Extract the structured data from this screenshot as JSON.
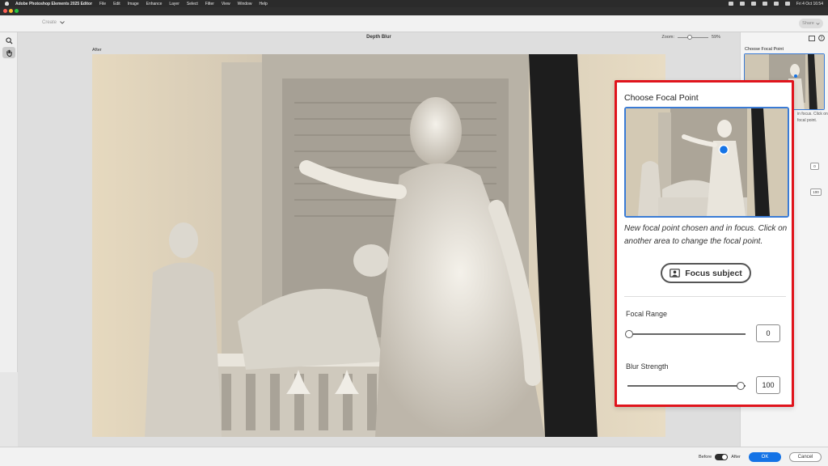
{
  "menubar": {
    "app_name": "Adobe Photoshop Elements 2025 Editor",
    "items": [
      "File",
      "Edit",
      "Image",
      "Enhance",
      "Layer",
      "Select",
      "Filter",
      "View",
      "Window",
      "Help"
    ],
    "datetime": "Fri 4 Oct  16:54"
  },
  "toolbar": {
    "create_label": "Create",
    "share_label": "Share"
  },
  "workspace": {
    "title": "Depth Blur",
    "zoom_label": "Zoom:",
    "zoom_value": "59%",
    "zoom_level": 0.59,
    "view_label": "After"
  },
  "right_panel": {
    "title": "Choose Focal Point",
    "faded_text_1": "in focus. Click on",
    "faded_text_2": "focal point.",
    "focal_range_value_small": "0",
    "blur_strength_value_small": "100"
  },
  "callout": {
    "title": "Choose Focal Point",
    "description": "New focal point chosen and in focus. Click on another area to change the focal point.",
    "focus_button_label": "Focus subject",
    "focal_range_label": "Focal Range",
    "focal_range_value": "0",
    "focal_range_level": 0,
    "blur_strength_label": "Blur Strength",
    "blur_strength_value": "100",
    "blur_strength_level": 1,
    "highlight_color": "#e0141c"
  },
  "bottombar": {
    "before_label": "Before",
    "after_label": "After",
    "ok_label": "OK",
    "cancel_label": "Cancel"
  },
  "colors": {
    "accent": "#1473e6",
    "selection_border": "#3a7bd5",
    "callout_border": "#e0141c"
  }
}
